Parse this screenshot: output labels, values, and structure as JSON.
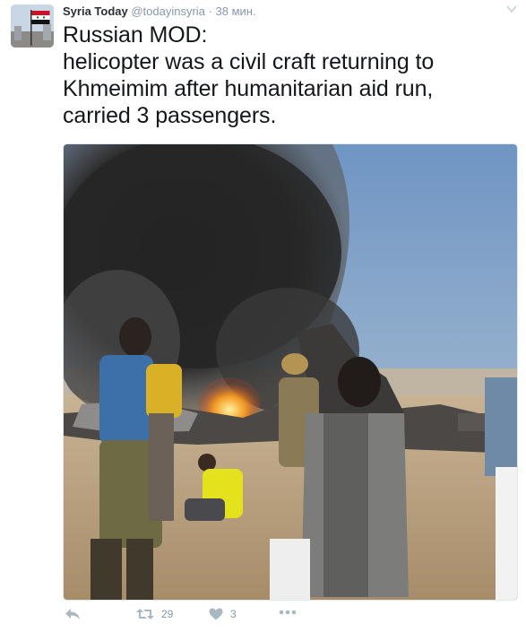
{
  "tweet": {
    "display_name": "Syria Today",
    "handle": "@todayinsyria",
    "separator": "·",
    "time": "38 мин.",
    "text_lines": [
      "Russian MOD:",
      "helicopter was a civil craft returning to",
      "Khmeimim after humanitarian aid run,",
      "carried 3 passengers."
    ],
    "avatar_icon": "syria-flag-avatar",
    "menu_icon": "chevron-down-icon"
  },
  "actions": {
    "reply_icon": "reply-icon",
    "retweet_icon": "retweet-icon",
    "retweet_count": "29",
    "like_icon": "heart-icon",
    "like_count": "3",
    "more_icon": "more-icon"
  },
  "colors": {
    "name": "#292f33",
    "meta": "#8899a6",
    "icon": "#aab8c2"
  }
}
